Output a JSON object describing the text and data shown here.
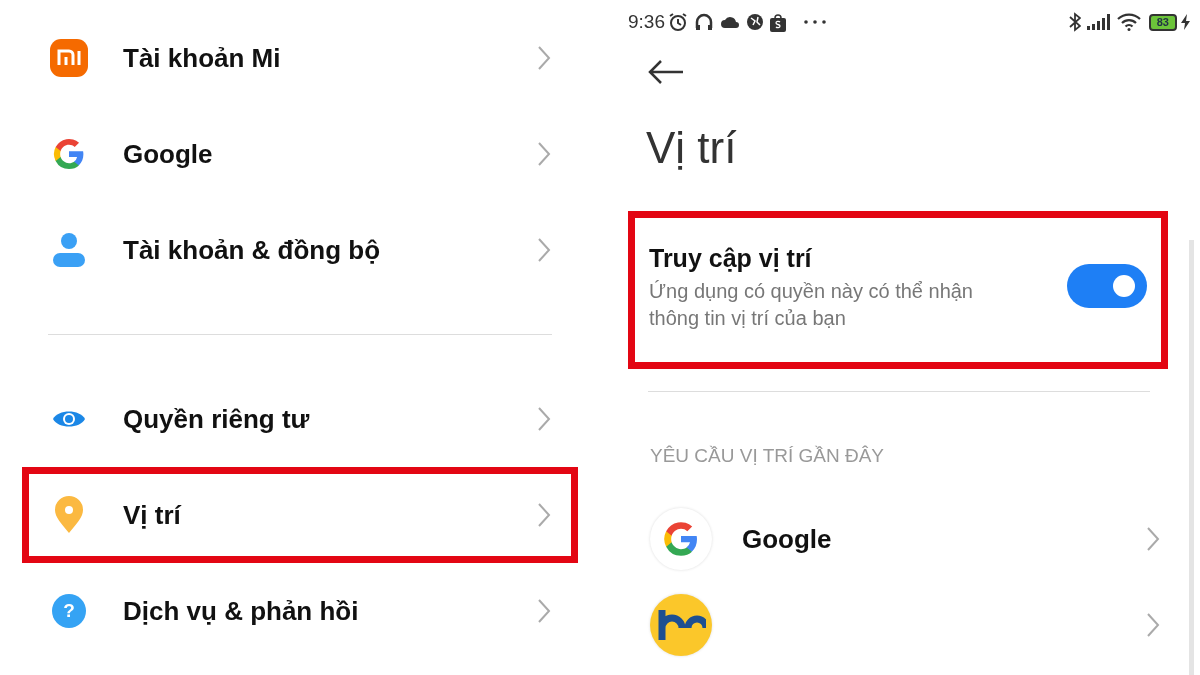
{
  "left_menu": {
    "items": [
      {
        "kind": "mi",
        "label": "Tài khoản Mi",
        "highlighted": false
      },
      {
        "kind": "google",
        "label": "Google",
        "highlighted": false
      },
      {
        "kind": "person",
        "label": "Tài khoản & đồng bộ",
        "highlighted": false
      },
      {
        "kind": "divider"
      },
      {
        "kind": "eye",
        "label": "Quyền riêng tư",
        "highlighted": false
      },
      {
        "kind": "pin",
        "label": "Vị trí",
        "highlighted": true
      },
      {
        "kind": "help",
        "icon_glyph": "?",
        "label": "Dịch vụ & phản hồi",
        "highlighted": false
      }
    ]
  },
  "status_bar": {
    "time": "9:36",
    "battery": "83",
    "charging": true
  },
  "location_screen": {
    "title": "Vị trí",
    "location_access": {
      "title": "Truy cập vị trí",
      "description": "Ứng dụng có quyền này có thể nhận thông tin vị trí của bạn",
      "on": true,
      "highlighted": true
    },
    "section_header": "YÊU CẦU VỊ TRÍ GẦN ĐÂY",
    "recent_apps": [
      {
        "kind": "google",
        "label": "Google"
      },
      {
        "kind": "app"
      }
    ]
  }
}
